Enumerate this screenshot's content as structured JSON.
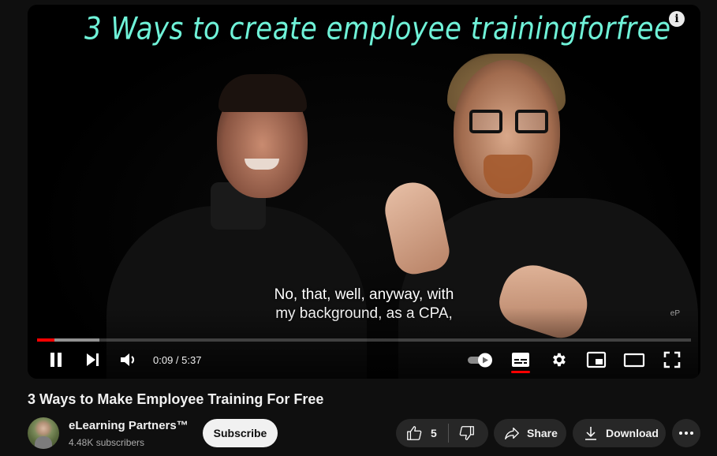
{
  "player": {
    "video_overlay_text": "3 Ways to create employee trainingforfree",
    "watermark": "eP",
    "captions": [
      "No, that, well, anyway, with",
      "my background, as a CPA,"
    ],
    "current_time": "0:09",
    "duration": "5:37",
    "time_display": "0:09 / 5:37",
    "progress_played_fraction": 0.027,
    "progress_buffered_fraction": 0.095,
    "autoplay_enabled": true,
    "captions_enabled": true,
    "state": "playing",
    "accent_color": "#ff0000",
    "icons": {
      "info": "info-icon",
      "pause": "pause-icon",
      "next": "next-icon",
      "volume": "volume-icon",
      "autoplay": "autoplay-toggle-icon",
      "subtitles": "subtitles-icon",
      "settings": "gear-icon",
      "miniplayer": "miniplayer-icon",
      "theater": "theater-mode-icon",
      "fullscreen": "fullscreen-icon"
    }
  },
  "video": {
    "title": "3 Ways to Make Employee Training For Free"
  },
  "channel": {
    "name": "eLearning Partners™",
    "subscribers": "4.48K subscribers",
    "subscribe_label": "Subscribe"
  },
  "actions": {
    "like_count": "5",
    "share_label": "Share",
    "download_label": "Download",
    "more_label": "..."
  }
}
